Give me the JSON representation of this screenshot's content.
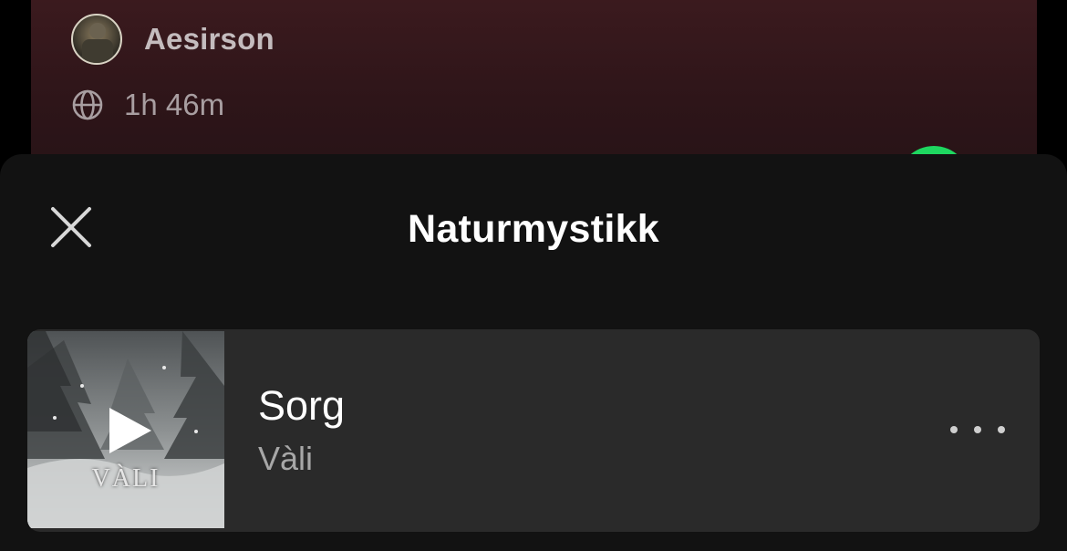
{
  "playlist_header": {
    "owner_name": "Aesirson",
    "duration": "1h 46m",
    "icons": {
      "visibility": "globe-icon",
      "owner": "avatar"
    }
  },
  "sheet": {
    "title": "Naturmystikk",
    "close_icon": "close-icon"
  },
  "track": {
    "title": "Sorg",
    "artist": "Vàli",
    "cover_band_text": "VÀLI",
    "play_icon": "play-icon",
    "more_icon": "more-horizontal-icon"
  },
  "colors": {
    "header_bg": "#3b1a1e",
    "sheet_bg": "#121212",
    "card_bg": "#2a2a2a",
    "accent_green": "#1ed760",
    "muted_text": "#a7a7a7"
  }
}
